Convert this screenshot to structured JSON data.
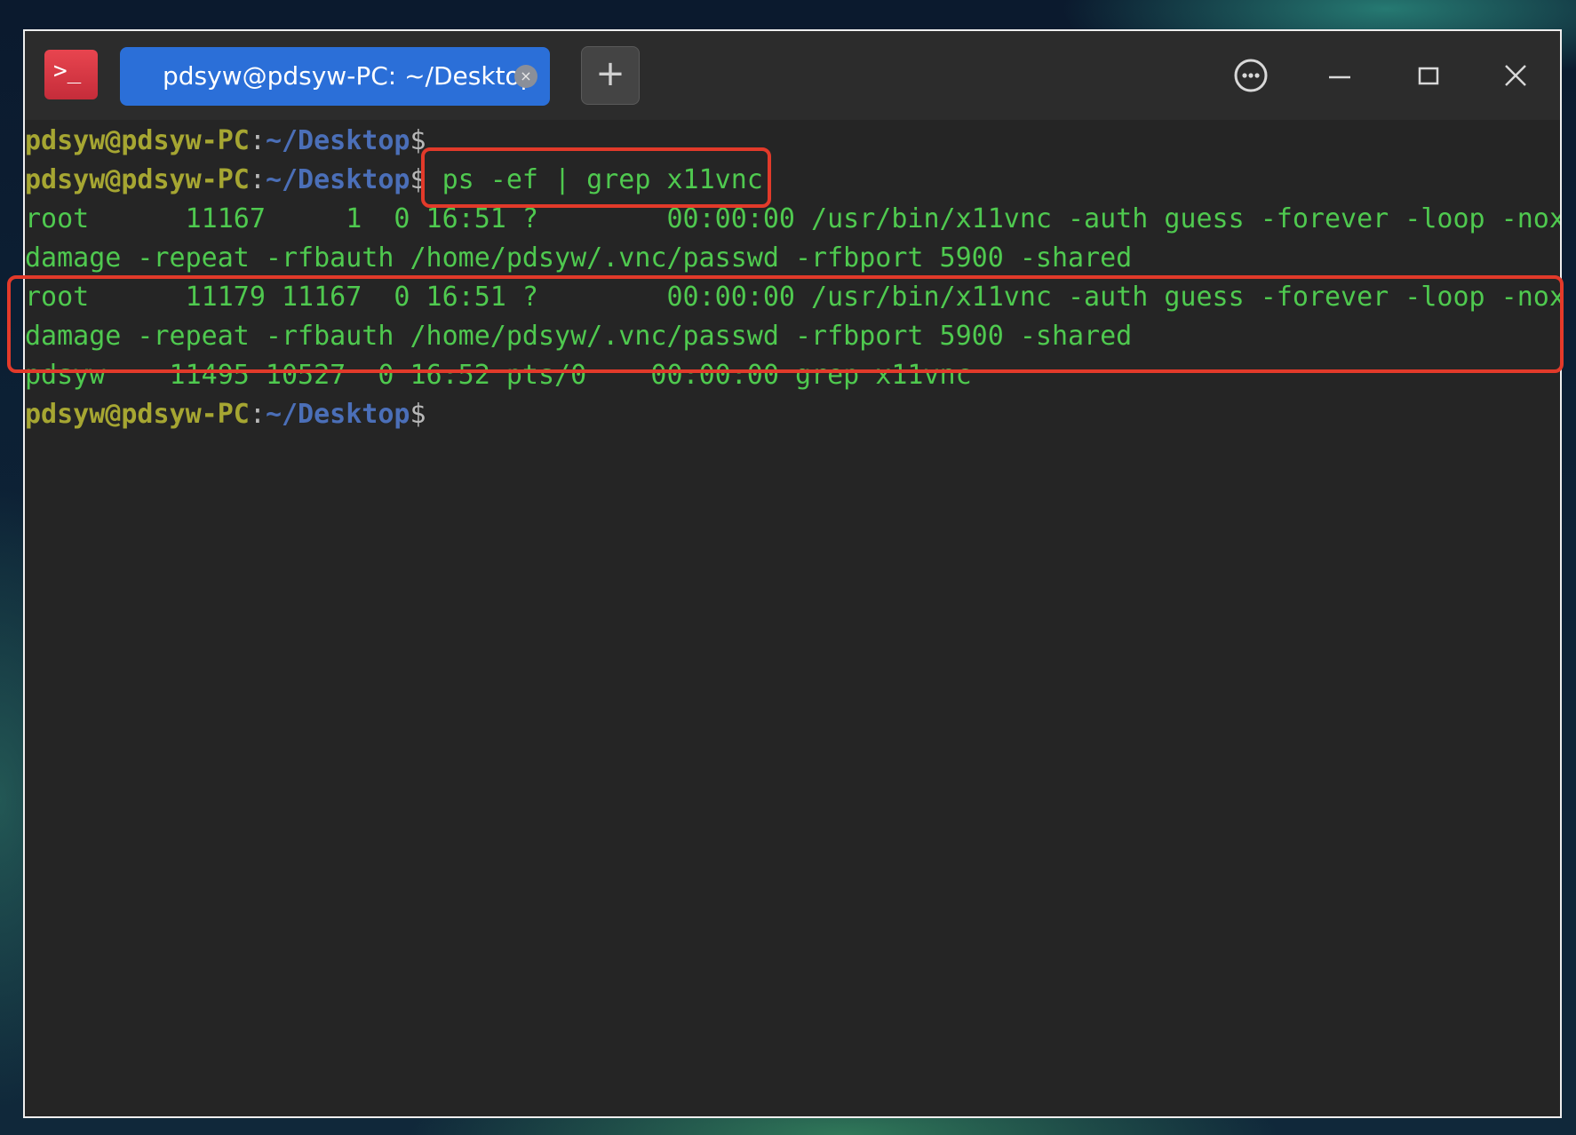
{
  "window": {
    "tab_title": "pdsyw@pdsyw-PC: ~/Desktop",
    "tab_close_glyph": "×",
    "new_tab_glyph": "+",
    "app_icon_glyph": ">_",
    "app_icon_name": "terminal-app-icon",
    "controls": [
      "menu-icon",
      "minimize-icon",
      "maximize-icon",
      "close-icon"
    ]
  },
  "prompt": {
    "user": "pdsyw@pdsyw-PC",
    "colon": ":",
    "path": "~/Desktop",
    "dollar": "$"
  },
  "terminal": {
    "command": " ps -ef | grep x11vnc",
    "lines": [
      "root      11167     1  0 16:51 ?        00:00:00 /usr/bin/x11vnc -auth guess -forever -loop -nox",
      "damage -repeat -rfbauth /home/pdsyw/.vnc/passwd -rfbport 5900 -shared",
      "root      11179 11167  0 16:51 ?        00:00:00 /usr/bin/x11vnc -auth guess -forever -loop -nox",
      "damage -repeat -rfbauth /home/pdsyw/.vnc/passwd -rfbport 5900 -shared",
      "pdsyw    11495 10527  0 16:52 pts/0    00:00:00 grep x11vnc"
    ]
  },
  "colors": {
    "terminal_bg": "#252525",
    "output_green": "#4fc94f",
    "prompt_user": "#a6a632",
    "prompt_path": "#4b6fb8",
    "tab_active": "#2b6fd8",
    "highlight": "#e23a2a"
  }
}
